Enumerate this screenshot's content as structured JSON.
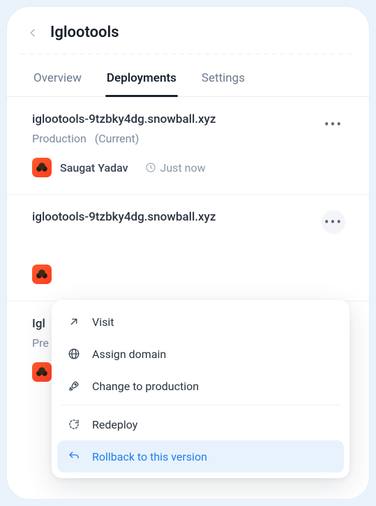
{
  "header": {
    "title": "Iglootools"
  },
  "tabs": [
    {
      "label": "Overview",
      "active": false
    },
    {
      "label": "Deployments",
      "active": true
    },
    {
      "label": "Settings",
      "active": false
    }
  ],
  "deployments": [
    {
      "url": "iglootools-9tzbky4dg.snowball.xyz",
      "env": "Production",
      "current": "(Current)",
      "author": "Saugat Yadav",
      "time": "Just now"
    },
    {
      "url": "iglootools-9tzbky4dg.snowball.xyz",
      "env": "",
      "current": "",
      "author": "",
      "time": ""
    },
    {
      "url": "Igl",
      "env": "Pre",
      "current": "",
      "author": "",
      "time": ""
    }
  ],
  "menu": {
    "visit": "Visit",
    "assign": "Assign domain",
    "change": "Change to production",
    "redeploy": "Redeploy",
    "rollback": "Rollback to this version"
  }
}
